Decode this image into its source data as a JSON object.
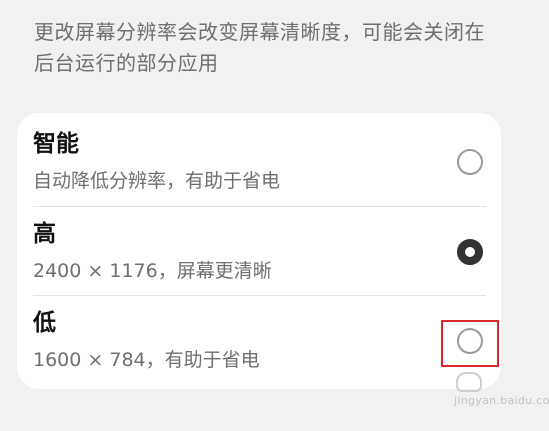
{
  "description": "更改屏幕分辨率会改变屏幕清晰度，可能会关闭在后台运行的部分应用",
  "options": [
    {
      "title": "智能",
      "subtitle": "自动降低分辨率，有助于省电",
      "selected": false
    },
    {
      "title": "高",
      "subtitle": "2400 × 1176，屏幕更清晰",
      "selected": true
    },
    {
      "title": "低",
      "subtitle": "1600 × 784，有助于省电",
      "selected": false
    }
  ],
  "watermark": {
    "text": "jingyan.baidu.com"
  },
  "colors": {
    "background": "#f1f1f1",
    "card": "#ffffff",
    "radio_checked": "#333333",
    "highlight": "#d9292b"
  }
}
